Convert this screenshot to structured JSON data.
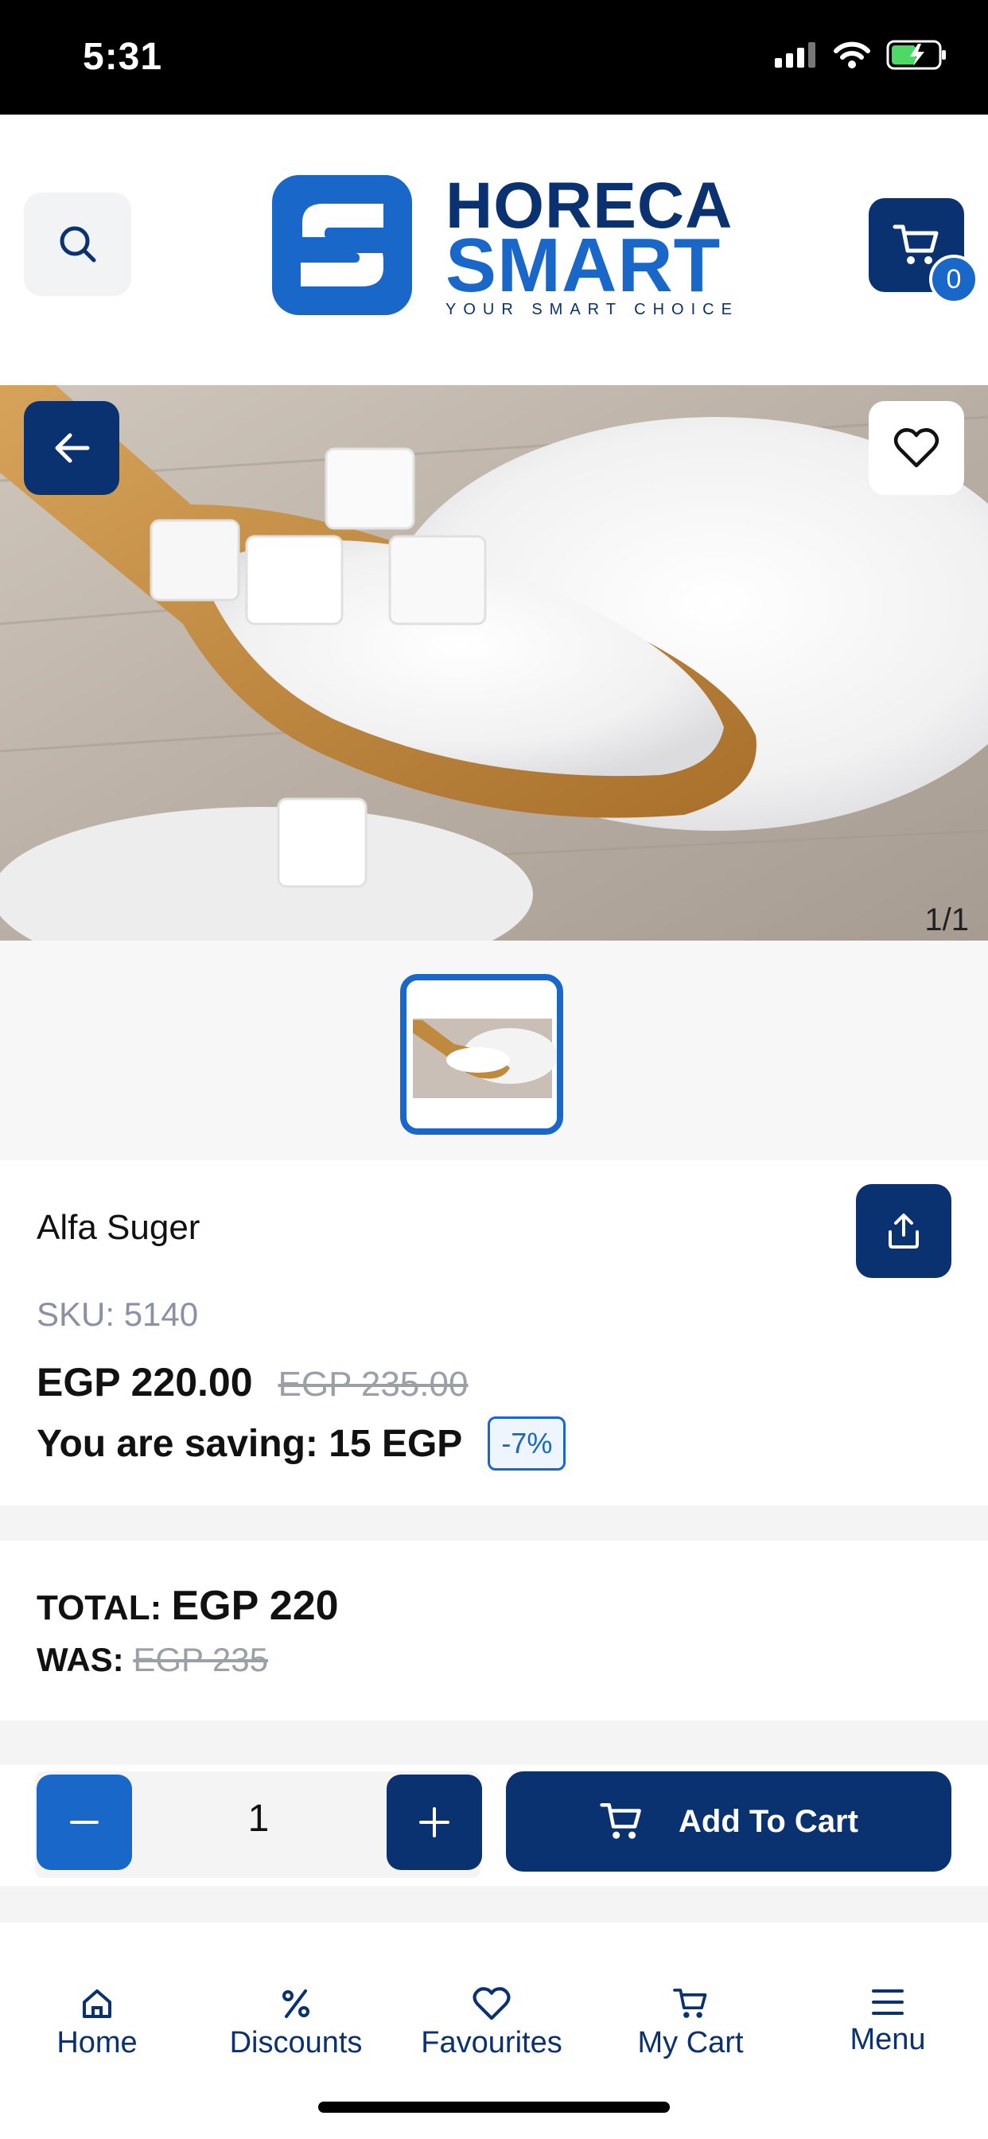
{
  "status_bar": {
    "time": "5:31"
  },
  "header": {
    "logo": {
      "line1": "HORECA",
      "line2": "SMART",
      "tagline": "YOUR SMART CHOICE"
    },
    "cart_count": "0",
    "search_icon": "search-icon",
    "cart_icon": "cart-icon"
  },
  "gallery": {
    "counter": "1/1",
    "back_icon": "arrow-left-icon",
    "favourite_icon": "heart-icon"
  },
  "product": {
    "name": "Alfa Suger",
    "sku_label": "SKU:",
    "sku_value": "5140",
    "price": "EGP 220.00",
    "old_price": "EGP 235.00",
    "saving_text": "You are saving: 15 EGP",
    "discount": "-7%"
  },
  "totals": {
    "total_label": "TOTAL:",
    "total_value": "EGP 220",
    "was_label": "WAS:",
    "was_value": "EGP 235"
  },
  "cart_controls": {
    "quantity": "1",
    "add_to_cart_label": "Add To Cart"
  },
  "bottom_nav": {
    "items": [
      {
        "label": "Home",
        "icon": "home-icon"
      },
      {
        "label": "Discounts",
        "icon": "percent-icon"
      },
      {
        "label": "Favourites",
        "icon": "heart-icon"
      },
      {
        "label": "My Cart",
        "icon": "cart-icon"
      },
      {
        "label": "Menu",
        "icon": "menu-icon"
      }
    ]
  },
  "colors": {
    "navy": "#0a3170",
    "blue": "#1867c9",
    "strike_gray": "#9aa0a6"
  }
}
